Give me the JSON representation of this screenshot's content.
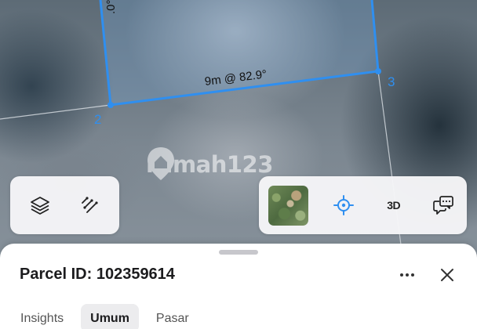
{
  "map": {
    "watermark": "rumah123",
    "vertices": [
      {
        "label": "2"
      },
      {
        "label": "3"
      }
    ],
    "edge_labels": [
      {
        "text": "9m @ 82.9°"
      },
      {
        "text": ".0°"
      }
    ],
    "accent_color": "#2f8ff0"
  },
  "toolbar_left": {
    "buttons": [
      {
        "icon": "layers-icon"
      },
      {
        "icon": "measure-icon"
      }
    ]
  },
  "toolbar_right": {
    "basemap_thumbnail": "satellite-thumbnail",
    "buttons": [
      {
        "icon": "locate-icon",
        "color": "#2f8ff0"
      },
      {
        "label": "3D"
      },
      {
        "icon": "feedback-icon"
      }
    ]
  },
  "sheet": {
    "title": "Parcel ID: 102359614",
    "tabs": [
      {
        "label": "Insights",
        "active": false
      },
      {
        "label": "Umum",
        "active": true
      },
      {
        "label": "Pasar",
        "active": false
      }
    ]
  }
}
